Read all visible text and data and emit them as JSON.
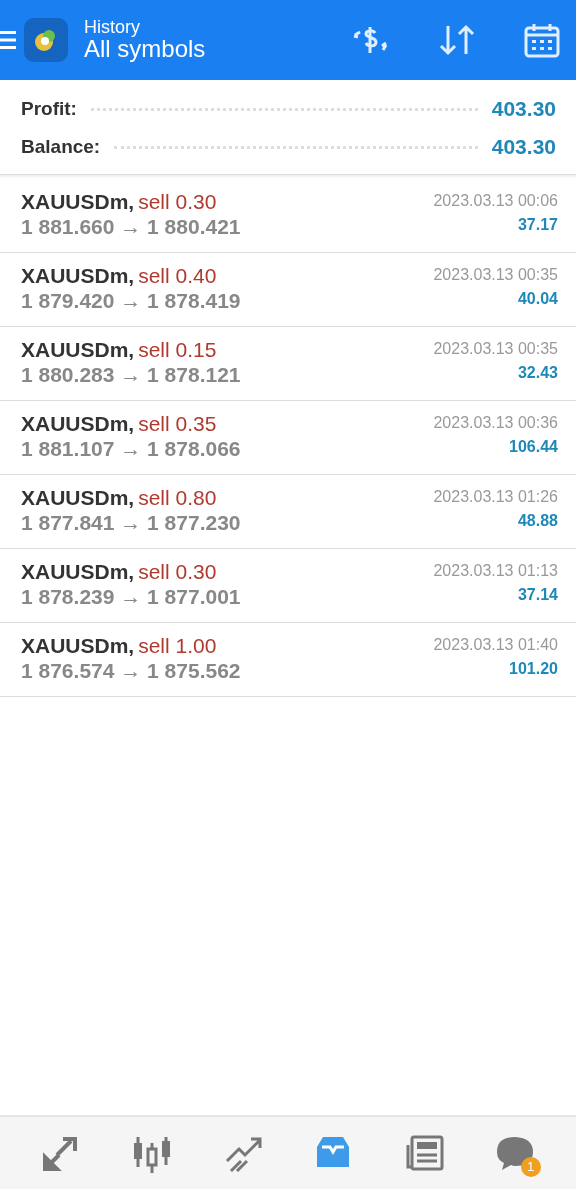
{
  "header": {
    "subtitle": "History",
    "title": "All symbols"
  },
  "summary": [
    {
      "label": "Profit:",
      "value": "403.30"
    },
    {
      "label": "Balance:",
      "value": "403.30"
    }
  ],
  "deals": [
    {
      "symbol": "XAUUSDm,",
      "side": "sell 0.30",
      "prices": "1 881.660 → 1 880.421",
      "time": "2023.03.13 00:06",
      "profit": "37.17"
    },
    {
      "symbol": "XAUUSDm,",
      "side": "sell 0.40",
      "prices": "1 879.420 → 1 878.419",
      "time": "2023.03.13 00:35",
      "profit": "40.04"
    },
    {
      "symbol": "XAUUSDm,",
      "side": "sell 0.15",
      "prices": "1 880.283 → 1 878.121",
      "time": "2023.03.13 00:35",
      "profit": "32.43"
    },
    {
      "symbol": "XAUUSDm,",
      "side": "sell 0.35",
      "prices": "1 881.107 → 1 878.066",
      "time": "2023.03.13 00:36",
      "profit": "106.44"
    },
    {
      "symbol": "XAUUSDm,",
      "side": "sell 0.80",
      "prices": "1 877.841 → 1 877.230",
      "time": "2023.03.13 01:26",
      "profit": "48.88"
    },
    {
      "symbol": "XAUUSDm,",
      "side": "sell 0.30",
      "prices": "1 878.239 → 1 877.001",
      "time": "2023.03.13 01:13",
      "profit": "37.14"
    },
    {
      "symbol": "XAUUSDm,",
      "side": "sell 1.00",
      "prices": "1 876.574 → 1 875.562",
      "time": "2023.03.13 01:40",
      "profit": "101.20"
    }
  ],
  "bottom_nav": [
    {
      "kind": "quotes",
      "selected": false
    },
    {
      "kind": "chart",
      "selected": false
    },
    {
      "kind": "trade",
      "selected": false
    },
    {
      "kind": "history",
      "selected": true
    },
    {
      "kind": "news",
      "selected": false
    },
    {
      "kind": "chat",
      "selected": false,
      "badge": "1"
    }
  ]
}
